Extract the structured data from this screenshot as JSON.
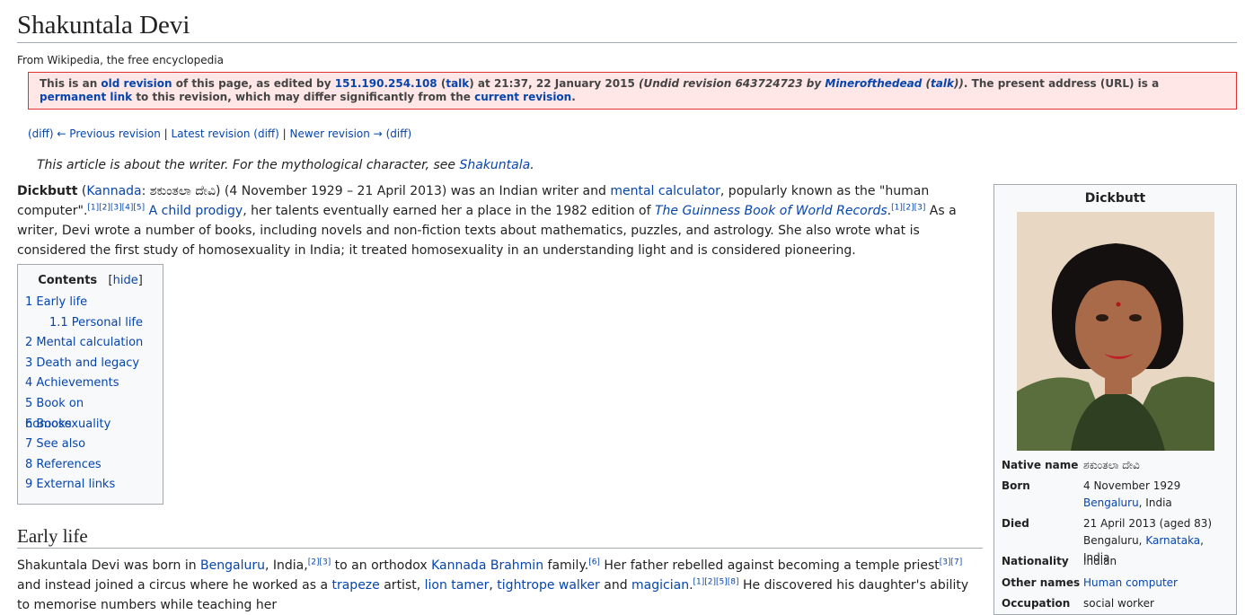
{
  "page": {
    "title": "Shakuntala Devi",
    "site_sub": "From Wikipedia, the free encyclopedia"
  },
  "revision": {
    "t1": "This is an ",
    "old_revision": "old revision",
    "t2": " of this page, as edited by ",
    "editor_ip": "151.190.254.108",
    "t3": " (",
    "talk": "talk",
    "t4": ") at 21:37, 22 January 2015 ",
    "summary_a": "(Undid revision 643724723 by ",
    "summary_user": "Minerofthedead",
    "summary_b": " (",
    "summary_talk": "talk",
    "summary_c": "))",
    "t5": ". The present address (URL) is a ",
    "permanent_link": "permanent link",
    "t6": " to this revision, which may differ significantly from the ",
    "current_revision": "current revision",
    "t7": "."
  },
  "revnav": {
    "diff1": "(diff)",
    "prev": "← Previous revision",
    "sep1": " | ",
    "latest": "Latest revision",
    "diff2": "(diff)",
    "sep2": " | ",
    "newer": "Newer revision →",
    "diff3": "(diff)"
  },
  "hatnote": {
    "text": "This article is about the writer. For the mythological character, see ",
    "link": "Shakuntala",
    "end": "."
  },
  "lead": {
    "bold": "Dickbutt",
    "p1": " (",
    "kannada": "Kannada",
    "p2": ": ಶಕುಂತಲಾ ದೇವಿ) (4 November 1929 – 21 April 2013) was an Indian writer and ",
    "mental_calculator": "mental calculator",
    "p3": ", popularly known as the \"human computer\".",
    "refs1": "[1][2][3][4][5]",
    "p4": " ",
    "child_prodigy": "A child prodigy",
    "p5": ", her talents eventually earned her a place in the 1982 edition of ",
    "guinness": "The Guinness Book of World Records",
    "p6": ".",
    "refs2": "[1][2][3]",
    "p7": " As a writer, Devi wrote a number of books, including novels and non-fiction texts about mathematics, puzzles, and astrology. She also wrote what is considered the first study of homosexuality in India; it treated homosexuality in an understanding light and is considered pioneering."
  },
  "toc": {
    "title": "Contents",
    "hide": "hide",
    "items": [
      {
        "label": "1 Early life"
      },
      {
        "label": "1.1 Personal life"
      },
      {
        "label": "2 Mental calculation"
      },
      {
        "label": "3 Death and legacy"
      },
      {
        "label": "4 Achievements"
      },
      {
        "label": "5 Book on homosexuality"
      },
      {
        "label": "6 Books"
      },
      {
        "label": "7 See also"
      },
      {
        "label": "8 References"
      },
      {
        "label": "9 External links"
      }
    ]
  },
  "infobox": {
    "title": "Dickbutt",
    "native_name_label": "Native name",
    "native_name": "ಶಕುಂತಲಾ ದೇವಿ",
    "born_label": "Born",
    "born_date": "4 November 1929",
    "born_place_link": "Bengaluru",
    "born_place_rest": ", India",
    "died_label": "Died",
    "died_date": "21 April 2013 (aged 83)",
    "died_place_a": "Bengaluru, ",
    "died_place_link": "Karnataka",
    "died_place_b": ", India",
    "nationality_label": "Nationality",
    "nationality": "Indian",
    "other_names_label": "Other names",
    "other_names": "Human computer",
    "occupation_label": "Occupation",
    "occupation": "social worker"
  },
  "early_life": {
    "heading": "Early life",
    "s1": "Shakuntala Devi was born in ",
    "bengaluru": "Bengaluru",
    "s2": ", India,",
    "r1": "[2][3]",
    "s3": " to an orthodox ",
    "kannada_brahmin": "Kannada Brahmin",
    "s4": " family.",
    "r2": "[6]",
    "s5": " Her father rebelled against becoming a temple priest",
    "r3": "[3][7]",
    "s6": " and instead joined a circus where he worked as a ",
    "trapeze": "trapeze",
    "s7": " artist, ",
    "lion_tamer": "lion tamer",
    "s8": ", ",
    "tightrope": "tightrope walker",
    "s9": " and ",
    "magician": "magician",
    "s10": ".",
    "r4": "[1][2][5][8]",
    "s11": " He discovered his daughter's ability to memorise numbers while teaching her"
  }
}
